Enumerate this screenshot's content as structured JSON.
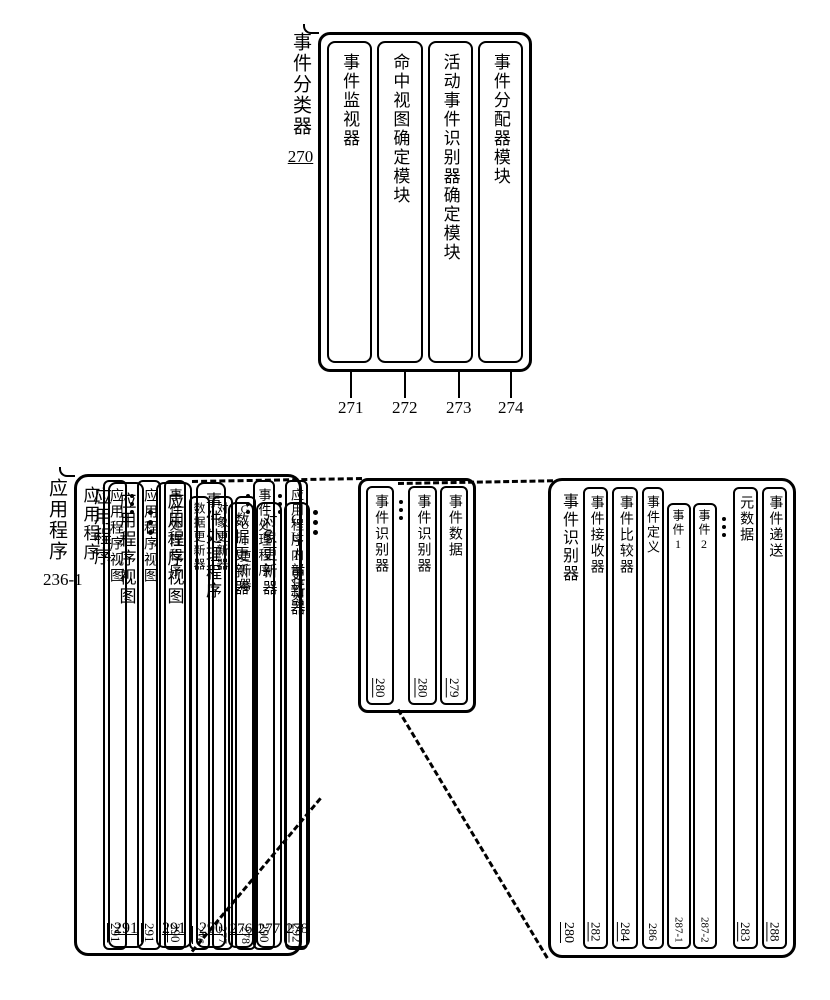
{
  "event_classifier": {
    "title": "事件分类器",
    "ref": "270",
    "rows": [
      {
        "label": "事件监视器",
        "ref": "271"
      },
      {
        "label": "命中视图确定模块",
        "ref": "272"
      },
      {
        "label": "活动事件识别器确定模块",
        "ref": "273"
      },
      {
        "label": "事件分配器模块",
        "ref": "274"
      }
    ]
  },
  "application": {
    "title": "应用程序",
    "ref": "236-1",
    "header": "应用程序",
    "views": {
      "label": "应用程序视图",
      "ref": "291"
    },
    "event_handler": {
      "label": "事件处理程序",
      "ref": "290"
    },
    "data_updater": {
      "label": "数据更新器",
      "ref": "276"
    },
    "object_updater": {
      "label": "对象更新器",
      "ref": "277"
    },
    "gui_updater": {
      "label": "GUI更新器",
      "ref": "278"
    },
    "internal_state": {
      "label": "应用程序内部状态",
      "ref": "292"
    }
  },
  "recognizer_list": {
    "item_label": "事件识别器",
    "item_ref": "280",
    "data_label": "事件数据",
    "data_ref": "279"
  },
  "event_recognizer": {
    "title": "事件识别器",
    "ref": "280",
    "receiver": {
      "label": "事件接收器",
      "ref": "282"
    },
    "comparator": {
      "label": "事件比较器",
      "ref": "284"
    },
    "definitions": {
      "label": "事件定义",
      "ref": "286"
    },
    "event1": {
      "label": "事件1",
      "ref": "287-1"
    },
    "event2": {
      "label": "事件2",
      "ref": "287-2"
    },
    "metadata": {
      "label": "元数据",
      "ref": "283"
    },
    "delivery": {
      "label": "事件递送",
      "ref": "288"
    }
  }
}
